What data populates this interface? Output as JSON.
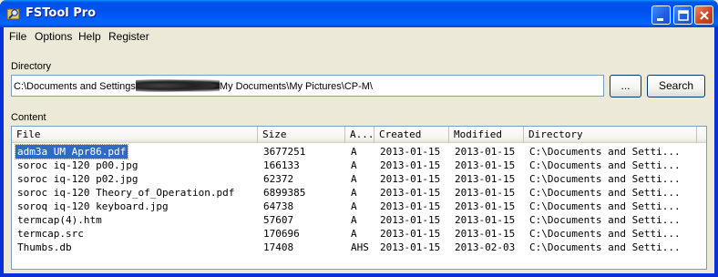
{
  "window": {
    "title": "FSTool Pro",
    "icon": "app-icon",
    "controls": [
      "minimize-icon",
      "maximize-icon",
      "close-icon"
    ]
  },
  "menu": {
    "file": "File",
    "options": "Options",
    "help": "Help",
    "register": "Register"
  },
  "directory": {
    "label": "Directory",
    "path_prefix": "C:\\Documents and Settings",
    "path_suffix": "My Documents\\My Pictures\\CP-M\\",
    "browse_label": "...",
    "search_label": "Search"
  },
  "content": {
    "label": "Content",
    "columns": [
      "File",
      "Size",
      "A...",
      "Created",
      "Modified",
      "Directory"
    ],
    "rows": [
      {
        "file": "adm3a UM Apr86.pdf",
        "size": "3677251",
        "attr": "A",
        "created": "2013-01-15",
        "modified": "2013-01-15",
        "directory": "C:\\Documents and Setti...",
        "selected": true
      },
      {
        "file": "soroc iq-120 p00.jpg",
        "size": "166133",
        "attr": "A",
        "created": "2013-01-15",
        "modified": "2013-01-15",
        "directory": "C:\\Documents and Setti..."
      },
      {
        "file": "soroc iq-120 p02.jpg",
        "size": "62372",
        "attr": "A",
        "created": "2013-01-15",
        "modified": "2013-01-15",
        "directory": "C:\\Documents and Setti..."
      },
      {
        "file": "soroc iq-120 Theory_of_Operation.pdf",
        "size": "6899385",
        "attr": "A",
        "created": "2013-01-15",
        "modified": "2013-01-15",
        "directory": "C:\\Documents and Setti..."
      },
      {
        "file": "soroq iq-120 keyboard.jpg",
        "size": "64738",
        "attr": "A",
        "created": "2013-01-15",
        "modified": "2013-01-15",
        "directory": "C:\\Documents and Setti..."
      },
      {
        "file": "termcap(4).htm",
        "size": "57607",
        "attr": "A",
        "created": "2013-01-15",
        "modified": "2013-01-15",
        "directory": "C:\\Documents and Setti..."
      },
      {
        "file": "termcap.src",
        "size": "170696",
        "attr": "A",
        "created": "2013-01-15",
        "modified": "2013-01-15",
        "directory": "C:\\Documents and Setti..."
      },
      {
        "file": "Thumbs.db",
        "size": "17408",
        "attr": "AHS",
        "created": "2013-01-15",
        "modified": "2013-02-03",
        "directory": "C:\\Documents and Setti..."
      }
    ]
  },
  "colors": {
    "titlebar": "#0054e3",
    "selection": "#316ac5",
    "face": "#ece9d8"
  }
}
